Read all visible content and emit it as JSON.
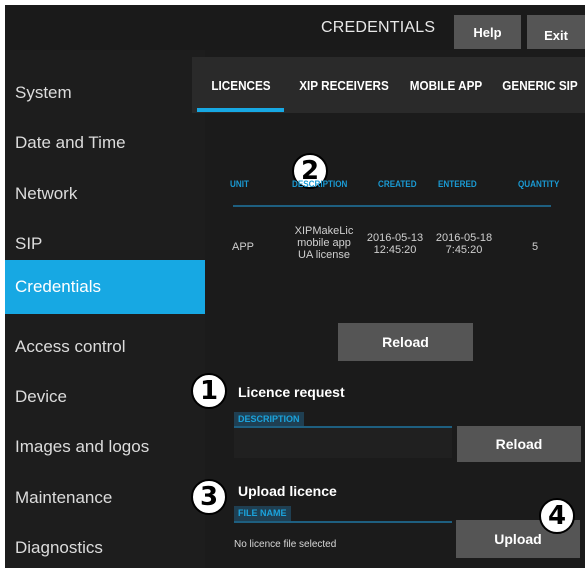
{
  "header": {
    "title": "CREDENTIALS",
    "help_label": "Help",
    "exit_label": "Exit"
  },
  "sidebar": {
    "items": [
      {
        "label": "System"
      },
      {
        "label": "Date and Time"
      },
      {
        "label": "Network"
      },
      {
        "label": "SIP"
      },
      {
        "label": "Credentials",
        "active": true
      },
      {
        "label": "Access control"
      },
      {
        "label": "Device"
      },
      {
        "label": "Images and logos"
      },
      {
        "label": "Maintenance"
      },
      {
        "label": "Diagnostics"
      }
    ]
  },
  "tabs": [
    {
      "label": "LICENCES",
      "active": true
    },
    {
      "label": "XIP RECEIVERS"
    },
    {
      "label": "MOBILE APP"
    },
    {
      "label": "GENERIC SIP"
    }
  ],
  "licence_table": {
    "columns": [
      "UNIT",
      "DESCRIPTION",
      "CREATED",
      "ENTERED",
      "QUANTITY"
    ],
    "rows": [
      {
        "unit": "APP",
        "description": [
          "XIPMakeLic",
          "mobile app",
          "UA license"
        ],
        "created": [
          "2016-05-13",
          "12:45:20"
        ],
        "entered": [
          "2016-05-18",
          "7:45:20"
        ],
        "quantity": "5"
      }
    ],
    "reload_label": "Reload"
  },
  "licence_request": {
    "title": "Licence request",
    "field_label": "DESCRIPTION",
    "description_value": "",
    "reload_label": "Reload"
  },
  "upload_licence": {
    "title": "Upload licence",
    "field_label": "FILE NAME",
    "status_text": "No licence file selected",
    "upload_label": "Upload"
  },
  "callouts": [
    "1",
    "2",
    "3",
    "4"
  ],
  "colors": {
    "accent": "#17a8e3",
    "background": "#1b1b1b",
    "button": "#555555",
    "header_text": "#1a9ad3"
  }
}
